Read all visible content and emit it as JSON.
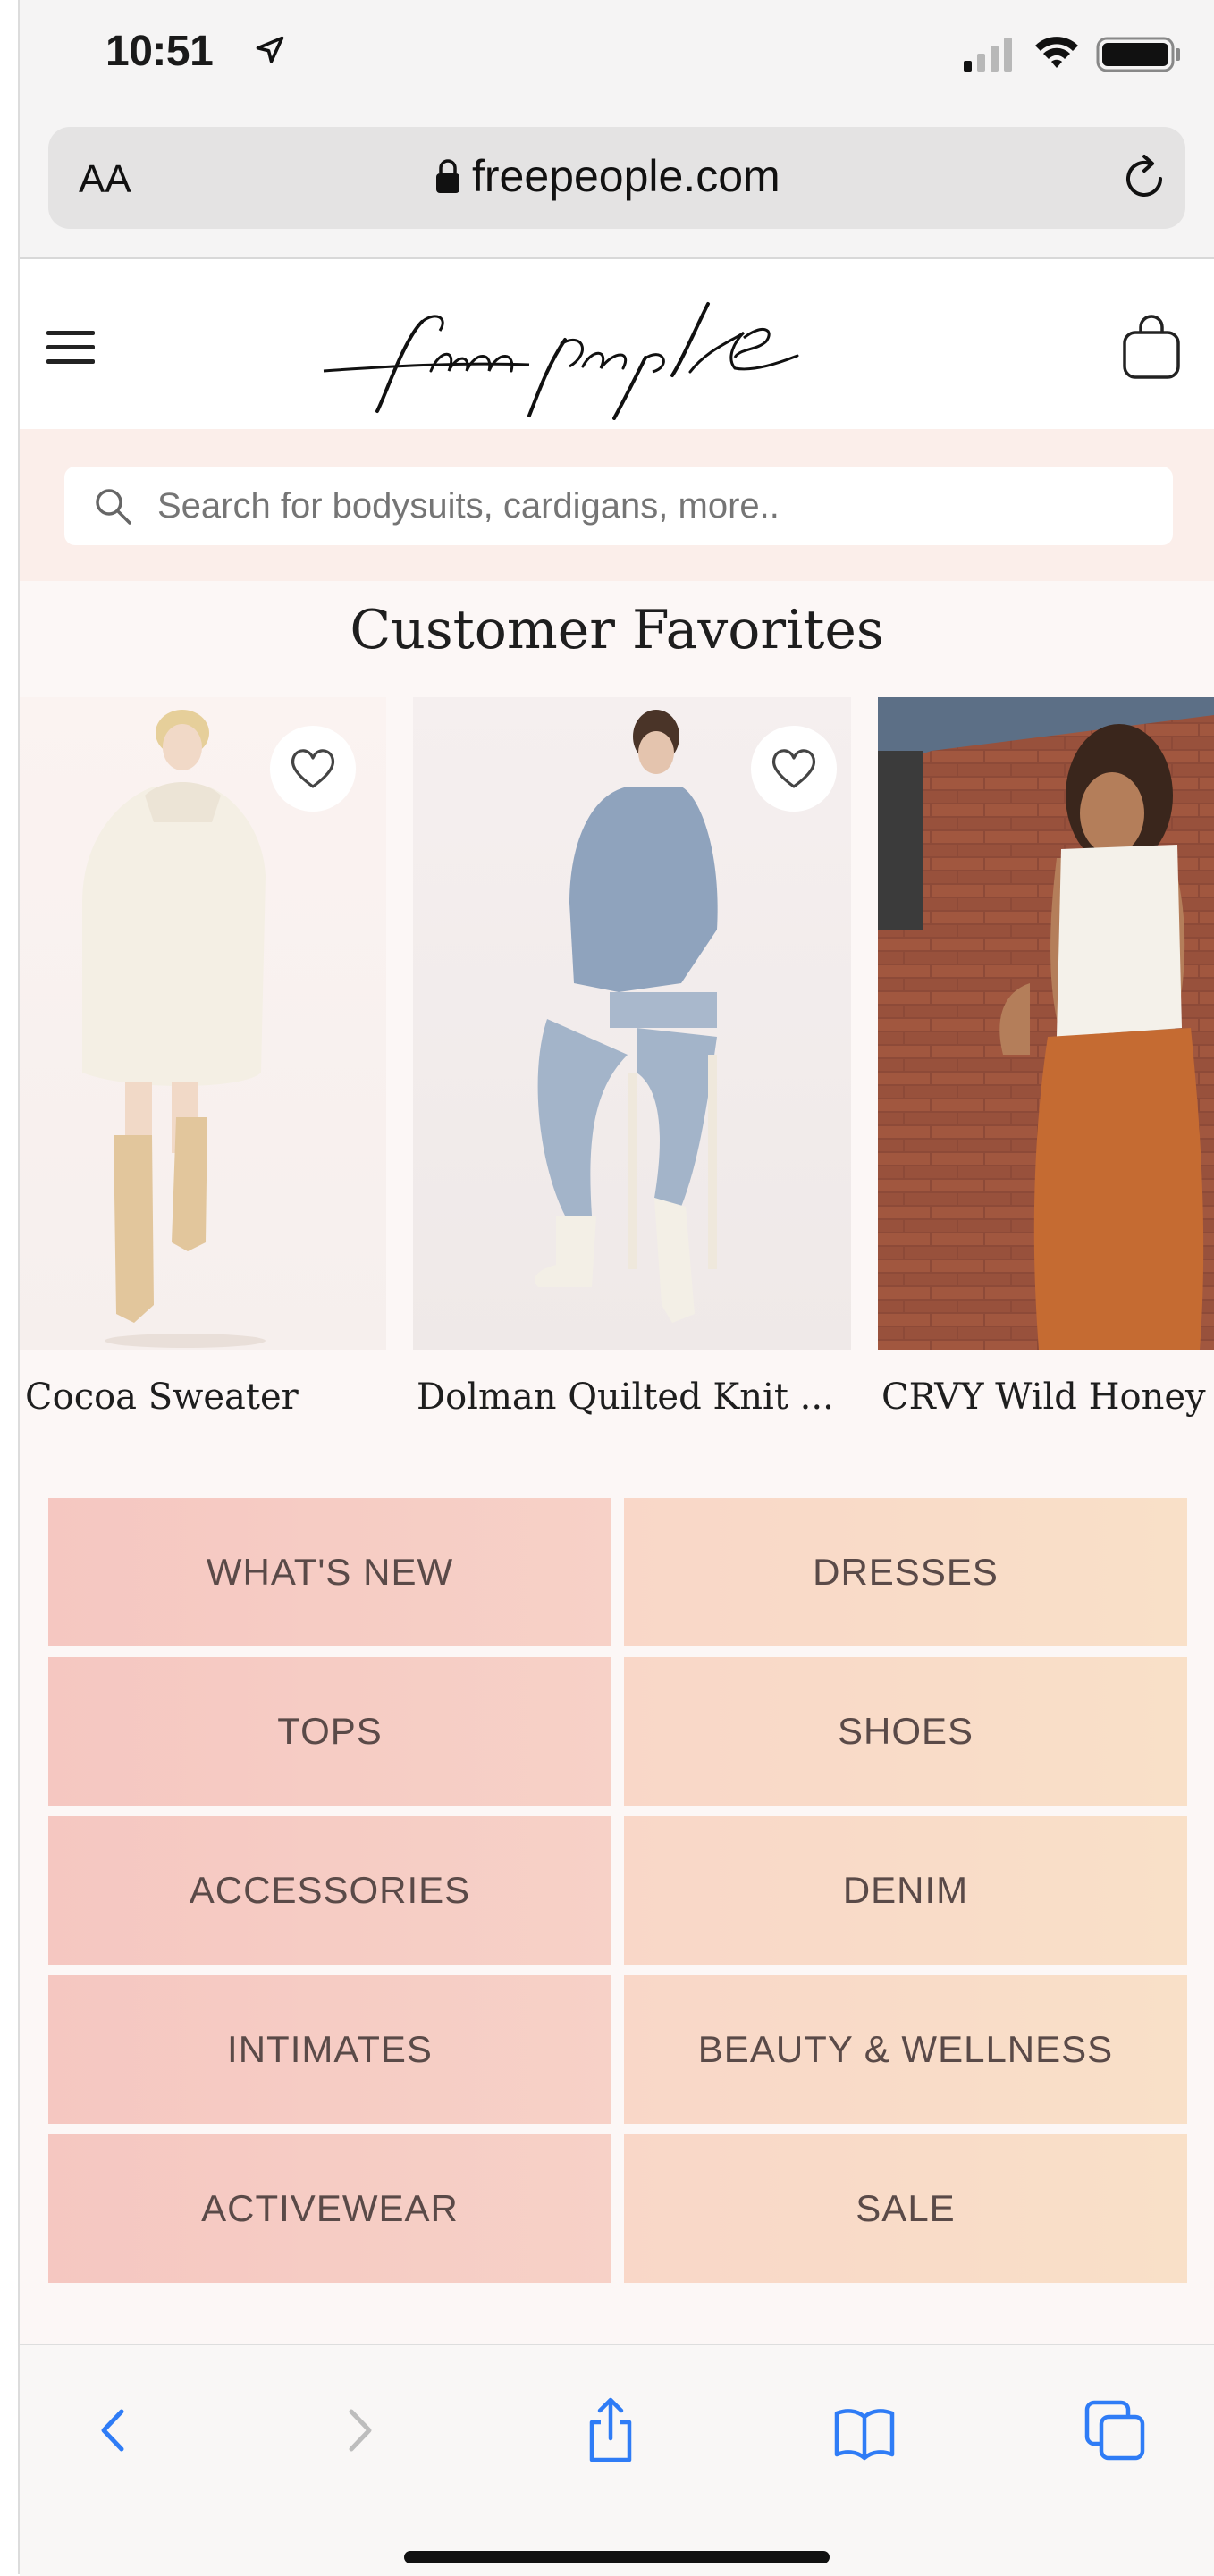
{
  "status": {
    "time": "10:51"
  },
  "browser": {
    "text_size_label": "AA",
    "domain": "freepeople.com"
  },
  "site": {
    "logo_text": "free people"
  },
  "search": {
    "placeholder": "Search for bodysuits, cardigans, more.."
  },
  "section": {
    "title": "Customer Favorites"
  },
  "products": [
    {
      "name": "Cocoa Sweater"
    },
    {
      "name": "Dolman Quilted Knit ..."
    },
    {
      "name": "CRVY Wild Honey"
    }
  ],
  "categories": [
    "WHAT'S NEW",
    "DRESSES",
    "TOPS",
    "SHOES",
    "ACCESSORIES",
    "DENIM",
    "INTIMATES",
    "BEAUTY & WELLNESS",
    "ACTIVEWEAR",
    "SALE"
  ],
  "colors": {
    "safari_blue": "#2f7cf6",
    "category_left": "#f5c7c1",
    "category_right": "#f9dcc8"
  },
  "icons": [
    "location-arrow-icon",
    "signal-icon",
    "wifi-icon",
    "battery-icon",
    "lock-icon",
    "reload-icon",
    "menu-icon",
    "bag-icon",
    "search-icon",
    "heart-icon",
    "back-icon",
    "forward-icon",
    "share-icon",
    "bookmarks-icon",
    "tabs-icon"
  ]
}
